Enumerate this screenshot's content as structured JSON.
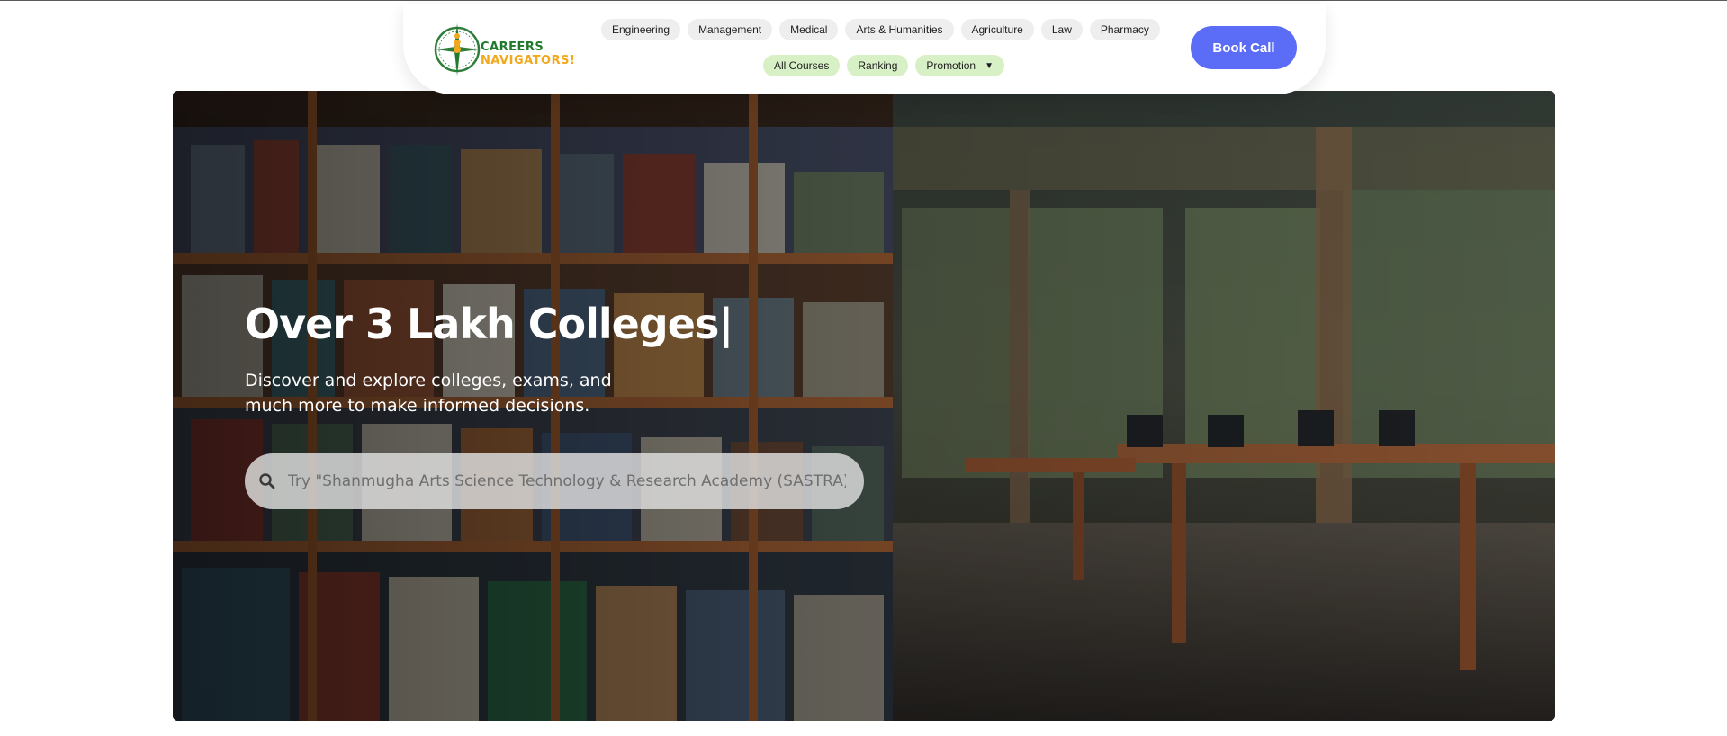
{
  "brand": {
    "line1": "CAREERS",
    "line2": "NAVIGATORS!",
    "colors": {
      "green": "#1f7a2e",
      "orange": "#f2a81d"
    }
  },
  "nav": {
    "primary": [
      "Engineering",
      "Management",
      "Medical",
      "Arts & Humanities",
      "Agriculture",
      "Law",
      "Pharmacy"
    ],
    "secondary": [
      "All Courses",
      "Ranking",
      "Promotion"
    ],
    "promotion_caret": "▼"
  },
  "cta": {
    "label": "Book Call",
    "color": "#5b6cf7"
  },
  "hero": {
    "title": "Over 3 Lakh Colleges|",
    "subtitle": "Discover and explore colleges, exams, and much more to make informed decisions.",
    "search_placeholder": "Try \"Shanmugha Arts Science Technology & Research Academy (SASTRA)\"",
    "search_icon": "search-icon"
  }
}
